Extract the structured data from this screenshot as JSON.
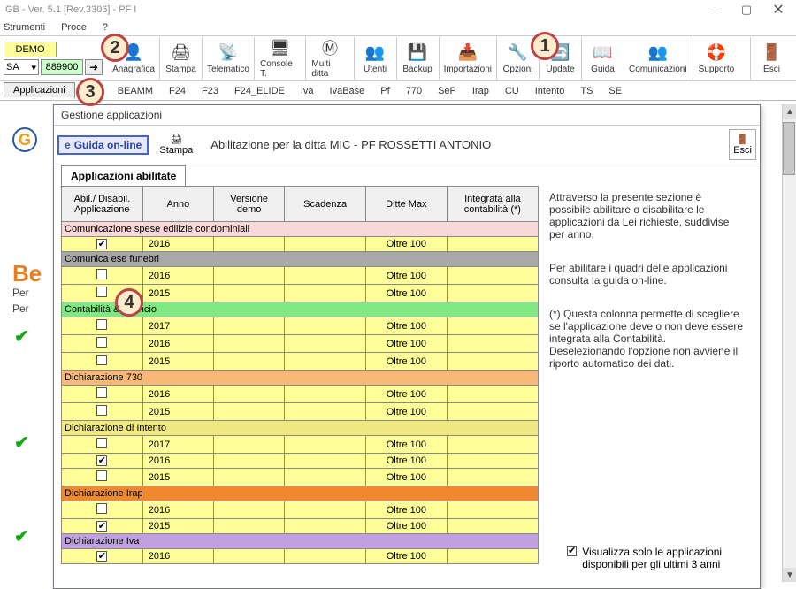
{
  "window": {
    "title": "GB - Ver. 5.1 [Rev.3306] - PF I"
  },
  "menu": [
    "Strumenti",
    "Proce",
    "?"
  ],
  "left_controls": {
    "demo": "DEMO",
    "select": "SA",
    "code": "889900"
  },
  "toolbar": [
    {
      "label": "Anagrafica",
      "icon": "👤"
    },
    {
      "label": "Stampa",
      "icon": "🖨"
    },
    {
      "label": "Telematico",
      "icon": "📡"
    },
    {
      "label": "Console T.",
      "icon": "🖥"
    },
    {
      "label": "Multi ditta",
      "icon": "Ⓜ"
    },
    {
      "label": "Utenti",
      "icon": "👥"
    },
    {
      "label": "Backup",
      "icon": "💾"
    },
    {
      "label": "Importazioni",
      "icon": "📥"
    },
    {
      "label": "Opzioni",
      "icon": "🔧"
    },
    {
      "label": "Update",
      "icon": "🔄"
    },
    {
      "label": "Guida",
      "icon": "📖"
    }
  ],
  "toolbar_right": [
    {
      "label": "Comunicazioni",
      "icon": "👥"
    },
    {
      "label": "Supporto",
      "icon": "🛟"
    }
  ],
  "toolbar_exit": {
    "label": "Esci",
    "icon": "🚪"
  },
  "app_tab": "Applicazioni",
  "tabbar": [
    "BEAMM",
    "F24",
    "F23",
    "F24_ELIDE",
    "Iva",
    "IvaBase",
    "Pf",
    "770",
    "SeP",
    "Irap",
    "CU",
    "Intento",
    "TS",
    "SE"
  ],
  "bg": {
    "be": "Be",
    "per": "Per",
    "per2": "Per"
  },
  "panel": {
    "title": "Gestione applicazioni",
    "guida": "Guida on-line",
    "stampa": "Stampa",
    "abil_title": "Abilitazione per la ditta MIC - PF ROSSETTI ANTONIO",
    "esci": "Esci",
    "tab": "Applicazioni abilitate"
  },
  "headers": {
    "abil": "Abil./ Disabil. Applicazione",
    "anno": "Anno",
    "vers": "Versione demo",
    "scad": "Scadenza",
    "ditte": "Ditte Max",
    "integ": "Integrata alla contabilità (*)"
  },
  "groups": [
    {
      "name": "Comunicazione spese edilizie condominiali",
      "color": "#f8d8d8",
      "rows": [
        {
          "chk": true,
          "anno": "2016",
          "ditte": "Oltre 100"
        }
      ]
    },
    {
      "name": "Comunica               ese funebri",
      "color": "#a8a8a8",
      "rows": [
        {
          "chk": false,
          "anno": "2016",
          "ditte": "Oltre 100"
        },
        {
          "chk": false,
          "anno": "2015",
          "ditte": "Oltre 100"
        }
      ]
    },
    {
      "name": "Contabilità & Bilancio",
      "color": "#80e880",
      "rows": [
        {
          "chk": false,
          "anno": "2017",
          "ditte": "Oltre 100"
        },
        {
          "chk": false,
          "anno": "2016",
          "ditte": "Oltre 100"
        },
        {
          "chk": false,
          "anno": "2015",
          "ditte": "Oltre 100"
        }
      ]
    },
    {
      "name": "Dichiarazione 730",
      "color": "#f8b878",
      "rows": [
        {
          "chk": false,
          "anno": "2016",
          "ditte": "Oltre 100"
        },
        {
          "chk": false,
          "anno": "2015",
          "ditte": "Oltre 100"
        }
      ]
    },
    {
      "name": "Dichiarazione di Intento",
      "color": "#f0e880",
      "rows": [
        {
          "chk": false,
          "anno": "2017",
          "ditte": "Oltre 100"
        },
        {
          "chk": true,
          "anno": "2016",
          "ditte": "Oltre 100"
        },
        {
          "chk": false,
          "anno": "2015",
          "ditte": "Oltre 100"
        }
      ]
    },
    {
      "name": "Dichiarazione Irap",
      "color": "#f08830",
      "rows": [
        {
          "chk": false,
          "anno": "2016",
          "ditte": "Oltre 100"
        },
        {
          "chk": true,
          "anno": "2015",
          "ditte": "Oltre 100"
        }
      ]
    },
    {
      "name": "Dichiarazione Iva",
      "color": "#c0a0e0",
      "rows": [
        {
          "chk": true,
          "anno": "2016",
          "ditte": "Oltre 100"
        }
      ]
    }
  ],
  "side": {
    "p1": "Attraverso la presente sezione è possibile abilitare o disabilitare le applicazioni da Lei richieste, suddivise per anno.",
    "p2": "Per abilitare i quadri delle applicazioni consulta la guida on-line.",
    "p3": "(*) Questa colonna permette di scegliere se l'applicazione deve o non deve essere integrata alla Contabilità. Deselezionando l'opzione non avviene il riporto automatico dei dati.",
    "check": "Visualizza solo le applicazioni disponibili per gli ultimi 3 anni"
  },
  "callouts": {
    "c1": "1",
    "c2": "2",
    "c3": "3",
    "c4": "4"
  }
}
